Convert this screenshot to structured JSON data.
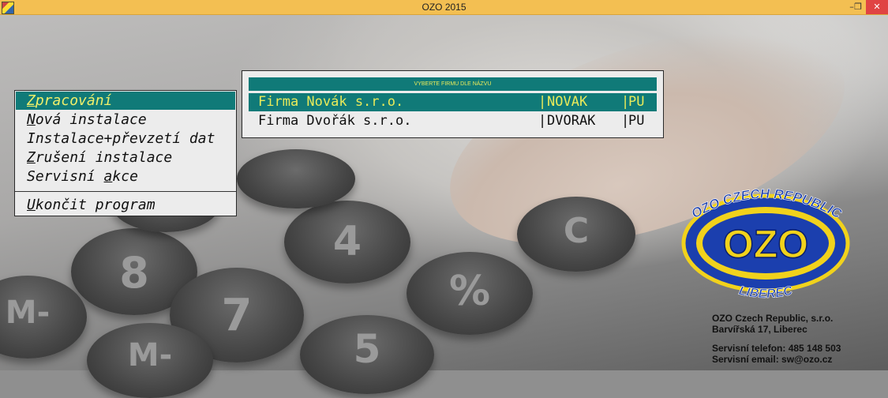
{
  "window": {
    "title": "OZO 2015",
    "icon": "app-icon",
    "controls": {
      "minimize": "–",
      "maximize": "❐",
      "close": "✕"
    }
  },
  "menu": {
    "items": [
      {
        "label": "Zpracování",
        "hotkey_index": 0,
        "selected": true
      },
      {
        "label": "Nová instalace",
        "hotkey_index": 0,
        "selected": false
      },
      {
        "label": "Instalace+převzetí dat",
        "hotkey_index": -1,
        "selected": false
      },
      {
        "label": "Zrušení instalace",
        "hotkey_index": 0,
        "selected": false
      },
      {
        "label": "Servisní akce",
        "hotkey_index": 9,
        "selected": false
      }
    ],
    "exit": {
      "label": "Ukončit program",
      "hotkey_index": 0
    }
  },
  "company_selector": {
    "header": "VYBERTE FIRMU DLE NÁZVU",
    "rows": [
      {
        "name": "Firma Novák s.r.o.",
        "code": "NOVAK",
        "type": "PU",
        "selected": true
      },
      {
        "name": "Firma Dvořák s.r.o.",
        "code": "DVORAK",
        "type": "PU",
        "selected": false
      }
    ],
    "separator": "|"
  },
  "logo": {
    "top_text": "OZO CZECH REPUBLIC",
    "center_text": "OZO",
    "bottom_text": "LIBEREC"
  },
  "company_info": {
    "name": "OZO Czech Republic, s.r.o.",
    "address": "Barvířská 17, Liberec",
    "phone": "Servisní telefon: 485 148 503",
    "email": "Servisní email: sw@ozo.cz"
  },
  "colors": {
    "titlebar": "#f3bf52",
    "selection_bg": "#107a78",
    "selection_fg": "#e9ea5a",
    "close_button": "#e04343",
    "logo_blue": "#1b3fae",
    "logo_yellow": "#f1d21c"
  }
}
